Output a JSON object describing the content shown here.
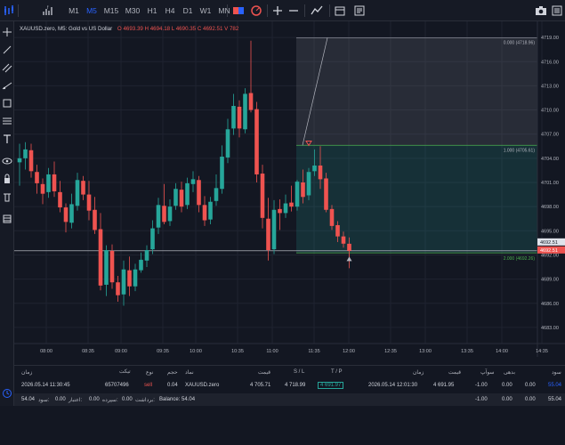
{
  "toolbar": {
    "timeframes": [
      "M1",
      "M5",
      "M15",
      "M30",
      "H1",
      "H4",
      "D1",
      "W1",
      "MN"
    ],
    "selected": "M5"
  },
  "legend": {
    "symbol": "XAUUSD.zero, M5: Gold vs US Dollar",
    "ohlc": "O 4693.39 H 4694.18 L 4690.35 C 4692.51 V 782"
  },
  "price_axis": {
    "ticks": [
      "4719.00",
      "4716.00",
      "4713.00",
      "4710.00",
      "4707.00",
      "4704.00",
      "4701.00",
      "4698.00",
      "4695.00",
      "4692.00",
      "4689.00",
      "4686.00",
      "4683.00"
    ],
    "current_price": "4692.51",
    "bid_label": "4692.51"
  },
  "time_axis": {
    "ticks": [
      "08:00",
      "08:35",
      "09:00",
      "09:35",
      "10:00",
      "10:35",
      "11:00",
      "11:35",
      "12:00",
      "12:35",
      "13:00",
      "13:35",
      "14:00",
      "14:35"
    ]
  },
  "fib": {
    "level_0": "0.000 (4718.96)",
    "level_1": "1.000 (4705.61)",
    "level_2": "2.000 (4692.26)"
  },
  "chart_data": {
    "type": "candlestick",
    "symbol": "XAUUSD.zero",
    "timeframe": "M5",
    "ylim": [
      4681,
      4721
    ],
    "candles": [
      [
        4703.5,
        4705.8,
        4700.6,
        4704.0
      ],
      [
        4704.0,
        4706.0,
        4702.6,
        4705.1
      ],
      [
        4705.0,
        4705.8,
        4701.6,
        4702.4
      ],
      [
        4702.3,
        4703.2,
        4699.6,
        4700.9
      ],
      [
        4700.8,
        4701.5,
        4698.3,
        4699.6
      ],
      [
        4699.8,
        4702.8,
        4699.1,
        4702.0
      ],
      [
        4702.0,
        4703.6,
        4699.2,
        4699.9
      ],
      [
        4699.8,
        4701.2,
        4697.3,
        4697.9
      ],
      [
        4697.9,
        4698.4,
        4694.8,
        4696.1
      ],
      [
        4696.0,
        4699.6,
        4695.3,
        4698.3
      ],
      [
        4698.1,
        4702.2,
        4697.5,
        4701.3
      ],
      [
        4701.2,
        4701.8,
        4698.8,
        4699.5
      ],
      [
        4699.5,
        4701.2,
        4696.3,
        4697.5
      ],
      [
        4697.6,
        4699.2,
        4694.6,
        4695.1
      ],
      [
        4695.2,
        4697.2,
        4687.6,
        4688.2
      ],
      [
        4688.3,
        4693.2,
        4686.9,
        4692.6
      ],
      [
        4692.5,
        4693.3,
        4687.8,
        4688.6
      ],
      [
        4688.6,
        4689.4,
        4686.2,
        4687.0
      ],
      [
        4687.1,
        4691.3,
        4685.7,
        4690.2
      ],
      [
        4690.1,
        4691.8,
        4686.9,
        4688.1
      ],
      [
        4688.1,
        4690.9,
        4687.5,
        4690.2
      ],
      [
        4690.1,
        4692.3,
        4689.8,
        4691.4
      ],
      [
        4691.3,
        4693.2,
        4690.5,
        4692.6
      ],
      [
        4692.7,
        4696.3,
        4692.1,
        4695.3
      ],
      [
        4695.4,
        4699.1,
        4694.6,
        4698.2
      ],
      [
        4698.1,
        4700.8,
        4695.8,
        4696.1
      ],
      [
        4696.2,
        4698.9,
        4695.6,
        4698.0
      ],
      [
        4698.1,
        4700.9,
        4697.6,
        4700.2
      ],
      [
        4700.1,
        4701.1,
        4697.3,
        4698.0
      ],
      [
        4698.2,
        4701.6,
        4697.7,
        4700.9
      ],
      [
        4700.8,
        4702.4,
        4699.8,
        4701.4
      ],
      [
        4701.3,
        4701.8,
        4697.3,
        4698.2
      ],
      [
        4698.2,
        4699.3,
        4695.6,
        4696.3
      ],
      [
        4696.4,
        4699.2,
        4695.8,
        4698.6
      ],
      [
        4698.7,
        4702.0,
        4698.1,
        4700.3
      ],
      [
        4700.2,
        4705.6,
        4699.6,
        4704.2
      ],
      [
        4704.1,
        4708.9,
        4703.4,
        4707.6
      ],
      [
        4707.7,
        4712.0,
        4706.9,
        4710.5
      ],
      [
        4710.4,
        4711.2,
        4706.6,
        4707.7
      ],
      [
        4707.6,
        4712.7,
        4707.1,
        4712.0
      ],
      [
        4712.1,
        4718.6,
        4709.7,
        4710.0
      ],
      [
        4710.1,
        4711.0,
        4701.0,
        4702.0
      ],
      [
        4702.1,
        4703.2,
        4695.3,
        4696.6
      ],
      [
        4696.5,
        4699.1,
        4691.3,
        4692.6
      ],
      [
        4692.7,
        4698.8,
        4692.1,
        4697.6
      ],
      [
        4697.7,
        4698.9,
        4695.1,
        4697.2
      ],
      [
        4697.2,
        4699.5,
        4696.6,
        4698.4
      ],
      [
        4698.5,
        4700.6,
        4697.4,
        4698.0
      ],
      [
        4698.0,
        4701.3,
        4697.5,
        4701.1
      ],
      [
        4701.0,
        4702.6,
        4698.4,
        4699.2
      ],
      [
        4699.4,
        4702.8,
        4698.8,
        4702.3
      ],
      [
        4702.4,
        4705.1,
        4701.8,
        4703.1
      ],
      [
        4703.1,
        4705.5,
        4700.2,
        4701.4
      ],
      [
        4701.5,
        4702.2,
        4697.3,
        4697.6
      ],
      [
        4697.7,
        4698.2,
        4695.1,
        4695.6
      ],
      [
        4695.7,
        4696.2,
        4693.6,
        4694.3
      ],
      [
        4694.3,
        4694.9,
        4692.9,
        4693.4
      ],
      [
        4693.39,
        4694.18,
        4690.35,
        4692.51
      ]
    ]
  },
  "trades_panel": {
    "headers_left": [
      "زمان",
      "تیکت",
      "نوع",
      "حجم",
      "نماد",
      "قیمت",
      "S / L",
      "T / P"
    ],
    "headers_right": [
      "زمان",
      "قیمت",
      "سوآپ",
      "بدهی",
      "سود"
    ],
    "row": {
      "time": "2026.05.14 11:30:45",
      "ticket": "65707496",
      "type": "sell",
      "volume": "0.04",
      "symbol": "XAUUSD.zero",
      "price": "4 705.71",
      "sl": "4 718.99",
      "tp": "4 691.97",
      "close_time": "2026.05.14 12:01:30",
      "close_price": "4 691.95",
      "swap": "-1.00",
      "c1": "0.00",
      "c2": "0.00",
      "profit": "55.04"
    },
    "summary": {
      "profit_label": "سود:",
      "profit": "54.04",
      "credit_label": "اعتبار:",
      "credit": "0.00",
      "deposit_label": "سپرده:",
      "deposit": "0.00",
      "withdraw_label": "برداشت:",
      "withdraw": "0.00",
      "balance": "Balance: 54.04",
      "v1": "-1.00",
      "v2": "0.00",
      "v3": "0.00",
      "v4": "55.04"
    }
  }
}
